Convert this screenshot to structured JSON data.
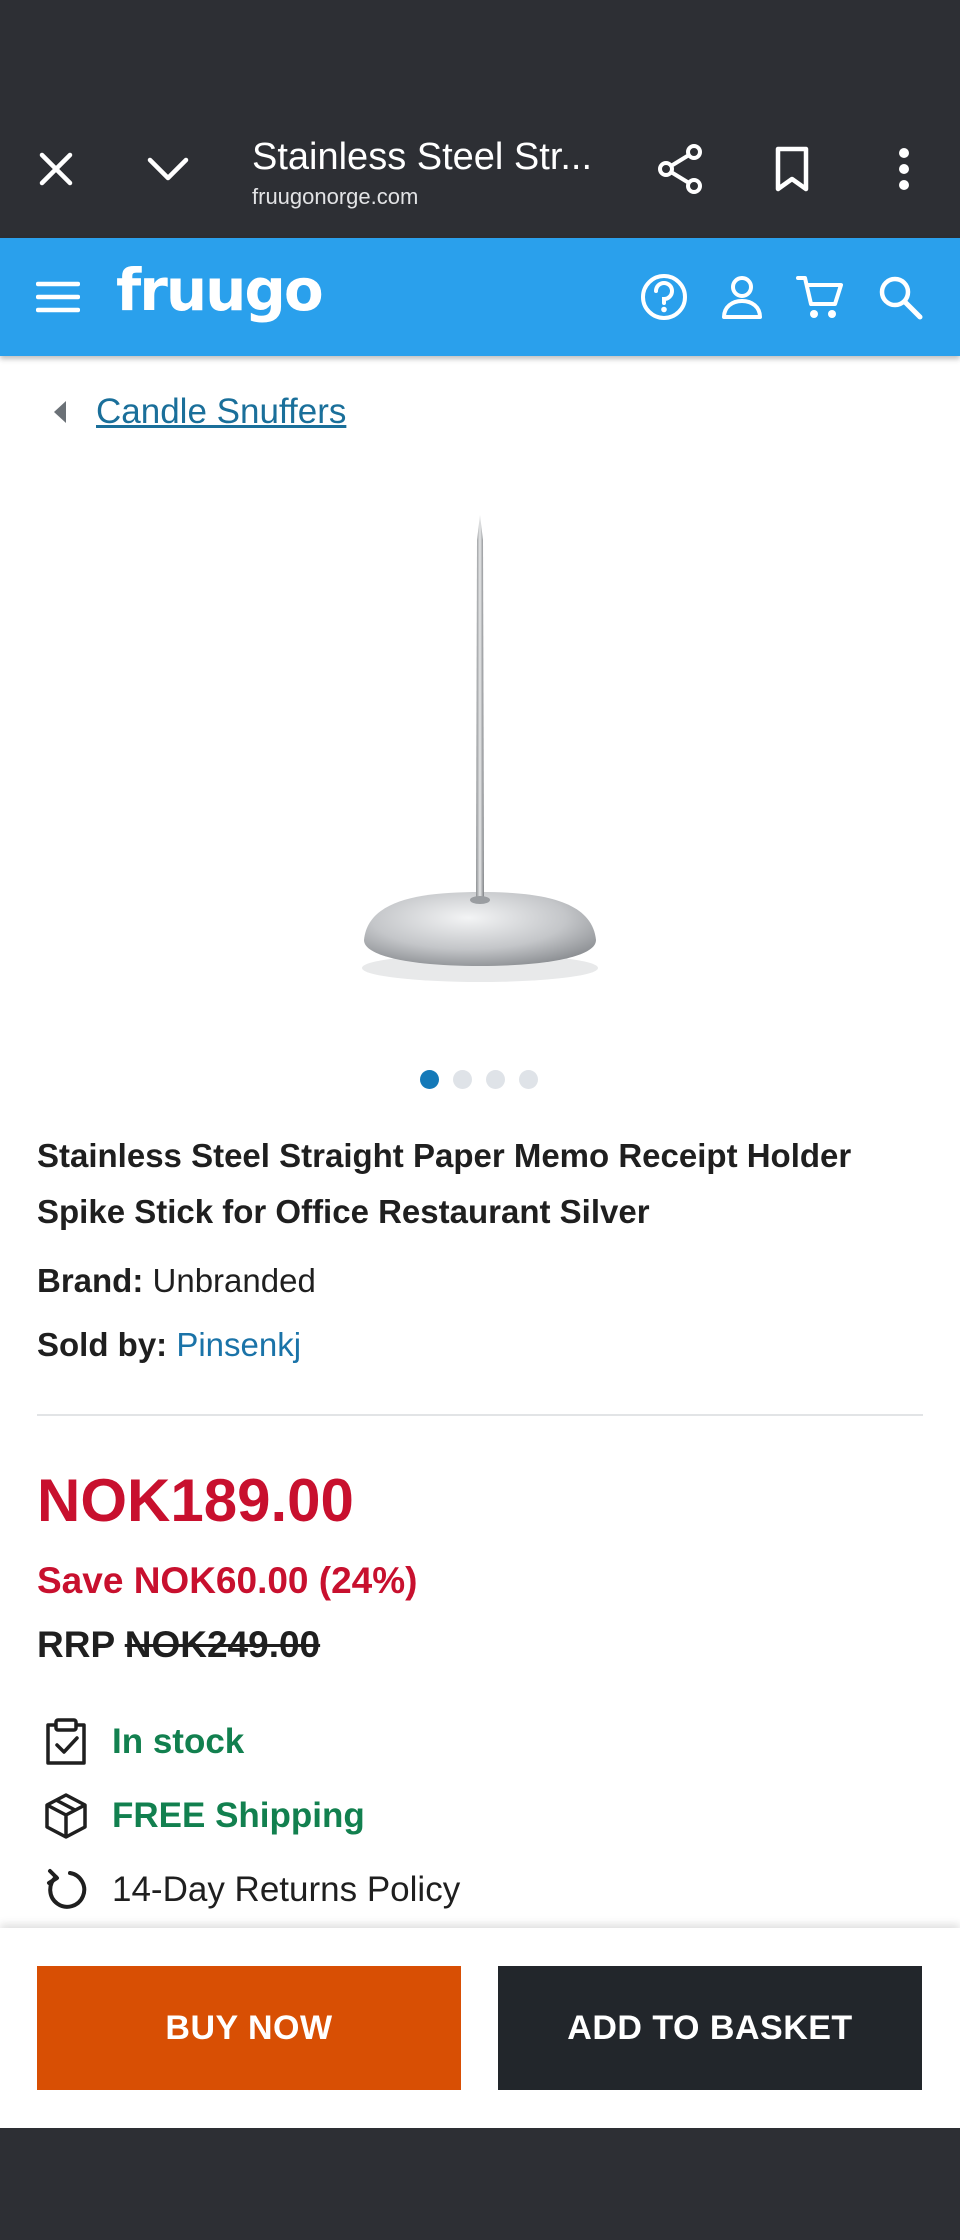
{
  "browser": {
    "title": "Stainless Steel Str...",
    "url": "fruugonorge.com"
  },
  "site": {
    "logo": "fruugo",
    "accent_color": "#2aa0ec"
  },
  "breadcrumb": {
    "label": "Candle Snuffers"
  },
  "gallery": {
    "slide_count": 4,
    "active_index": 0
  },
  "product": {
    "title": "Stainless Steel Straight Paper Memo Receipt Holder Spike Stick for Office Restaurant Silver",
    "brand_label": "Brand:",
    "brand_value": "Unbranded",
    "seller_label": "Sold by:",
    "seller_value": "Pinsenkj"
  },
  "pricing": {
    "price": "NOK189.00",
    "save": "Save NOK60.00 (24%)",
    "rrp_label": "RRP",
    "rrp_value": "NOK249.00",
    "price_color": "#c8102e"
  },
  "features": [
    {
      "icon": "clipboard-check-icon",
      "text": "In stock"
    },
    {
      "icon": "package-icon",
      "text": "FREE Shipping"
    },
    {
      "icon": "returns-arrow-icon",
      "text": "14-Day Returns Policy"
    }
  ],
  "actions": {
    "buy_now": "BUY NOW",
    "add_to_basket": "ADD TO BASKET",
    "buy_color": "#d84f04",
    "basket_color": "#22262b"
  }
}
